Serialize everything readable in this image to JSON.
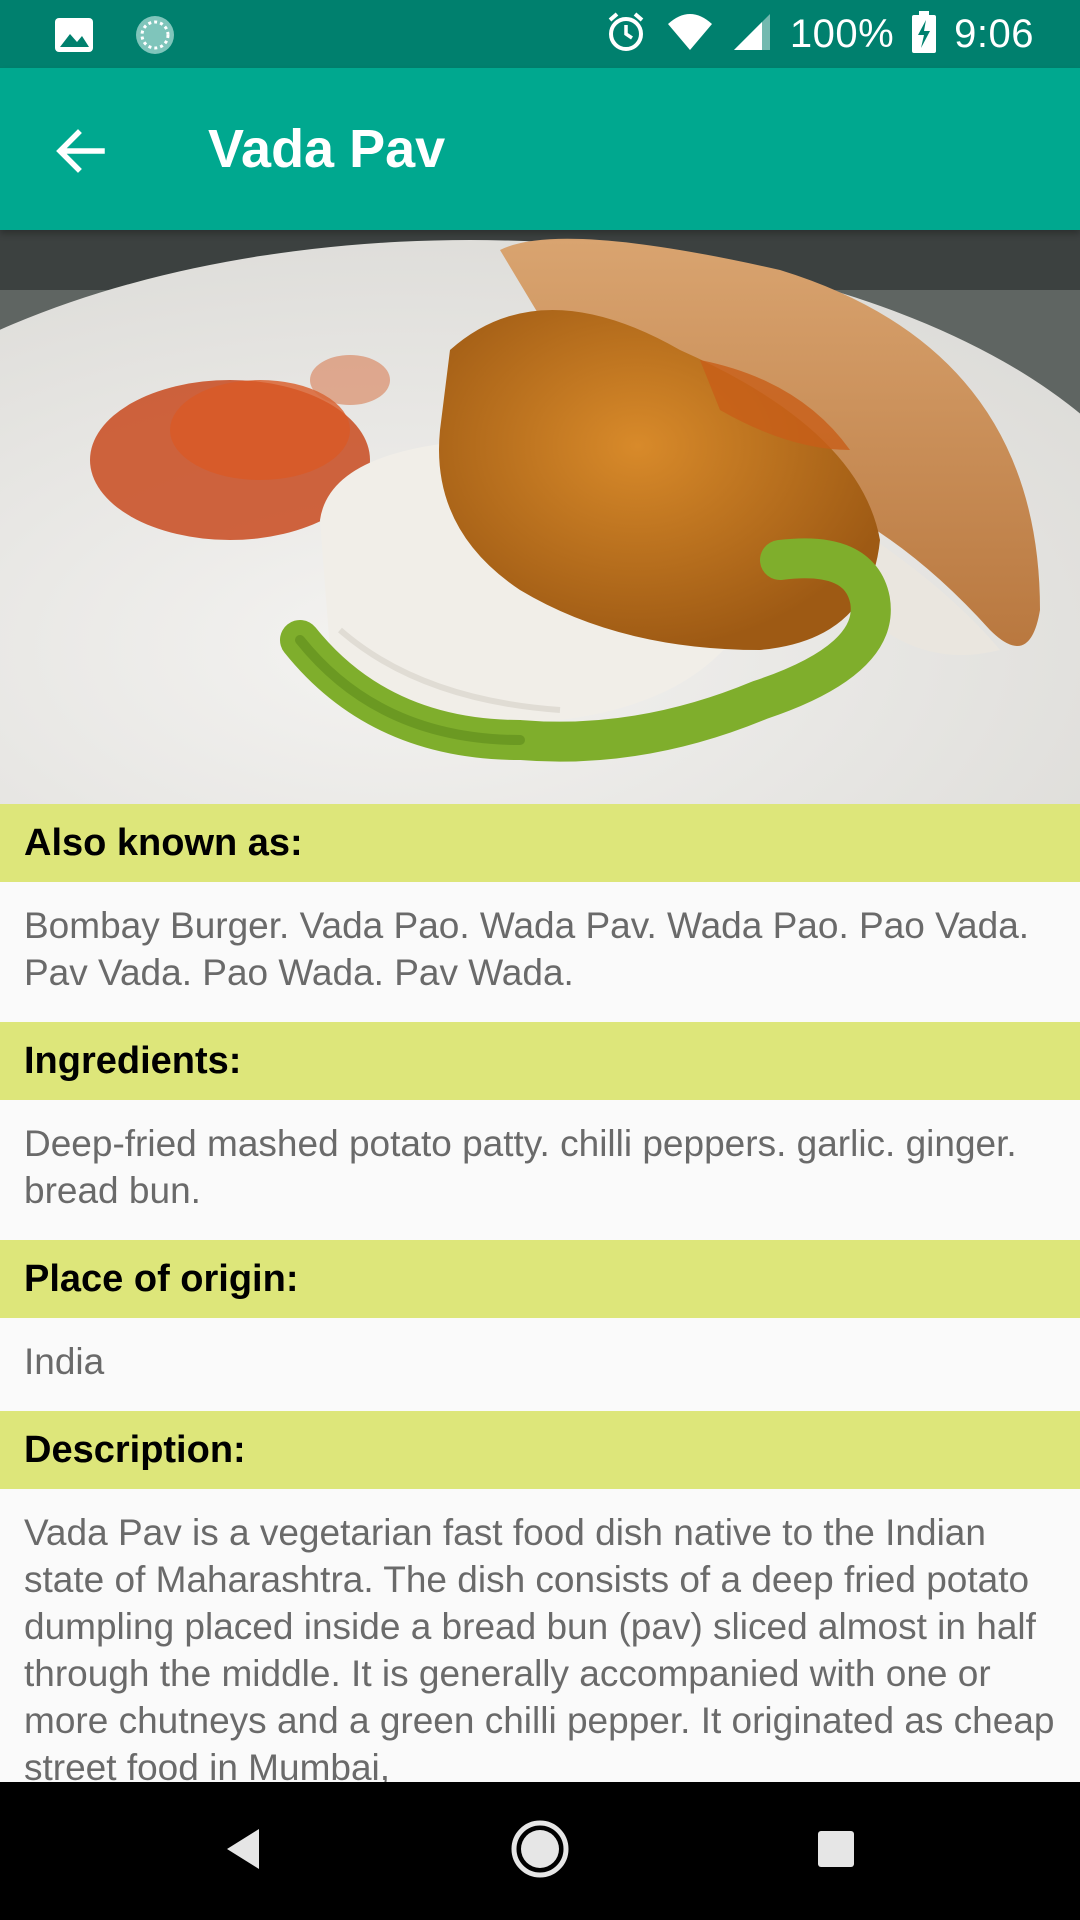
{
  "status_bar": {
    "battery": "100%",
    "time": "9:06",
    "icons": [
      "image-notification-icon",
      "sync-notification-icon",
      "alarm-icon",
      "wifi-icon",
      "cell-signal-icon",
      "battery-charging-icon"
    ]
  },
  "app_bar": {
    "title": "Vada Pav",
    "back_icon": "arrow-back-icon"
  },
  "hero": {
    "image": "vada-pav-photo"
  },
  "sections": [
    {
      "header": "Also known as:",
      "body": "Bombay Burger. Vada Pao. Wada Pav. Wada Pao. Pao Vada. Pav Vada. Pao Wada. Pav Wada."
    },
    {
      "header": "Ingredients:",
      "body": "Deep-fried mashed potato patty. chilli peppers. garlic. ginger. bread bun."
    },
    {
      "header": "Place of origin:",
      "body": "India"
    },
    {
      "header": "Description:",
      "body": "Vada Pav is a vegetarian fast food dish native to the Indian state of Maharashtra. The dish consists of a deep fried potato dumpling placed inside a bread bun (pav) sliced almost in half through the middle. It is generally accompanied with one or more chutneys and a green chilli pepper. It originated as cheap street food in Mumbai,"
    }
  ],
  "nav_bar": {
    "icons": [
      "back-triangle-icon",
      "home-circle-icon",
      "recents-square-icon"
    ]
  },
  "colors": {
    "status_bar": "#00806e",
    "app_bar": "#00a88f",
    "section_header": "#dde67a",
    "body_text": "#6a6a6a"
  }
}
